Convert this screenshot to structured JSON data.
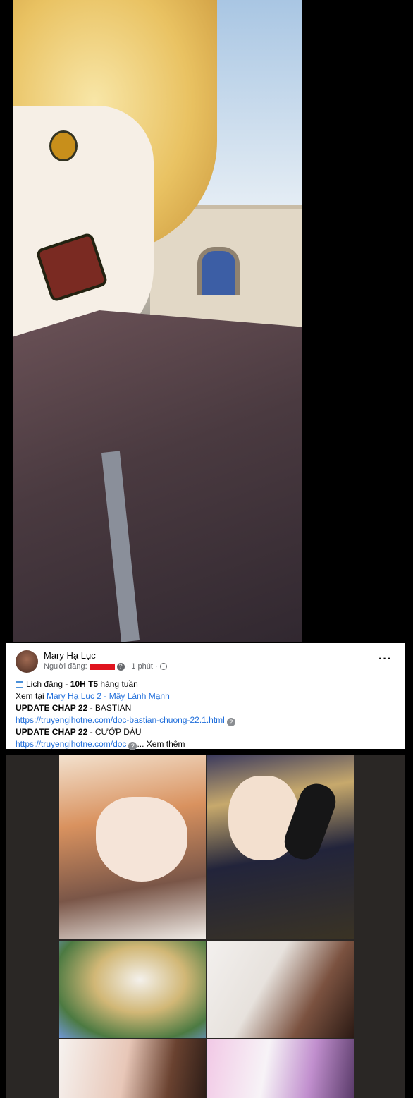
{
  "post": {
    "author": "Mary Hạ Lục",
    "poster_label": "Người đăng:",
    "time": "1 phút",
    "more_icon": "···",
    "schedule_prefix": "Lịch đăng - ",
    "schedule_bold": "10H T5",
    "schedule_suffix": " hàng tuần",
    "view_prefix": "Xem tại ",
    "view_link": "Mary Hạ Lục 2 - Mây Lành Mạnh",
    "update1_bold": "UPDATE CHAP 22",
    "update1_rest": " - BASTIAN",
    "update1_link": "https://truyengihotne.com/doc-bastian-chuong-22.1.html",
    "update2_bold": "UPDATE CHAP 22",
    "update2_rest": " - CƯỚP DÂU",
    "update2_link": "https://truyengihotne.com/doc",
    "see_more_ellipsis": "...",
    "see_more": " Xem thêm",
    "question_glyph": "?"
  },
  "icons": {
    "calendar": "calendar-icon",
    "globe": "globe-icon",
    "more": "more-icon"
  },
  "colors": {
    "link": "#216fdb",
    "redaction": "#e0141e"
  }
}
